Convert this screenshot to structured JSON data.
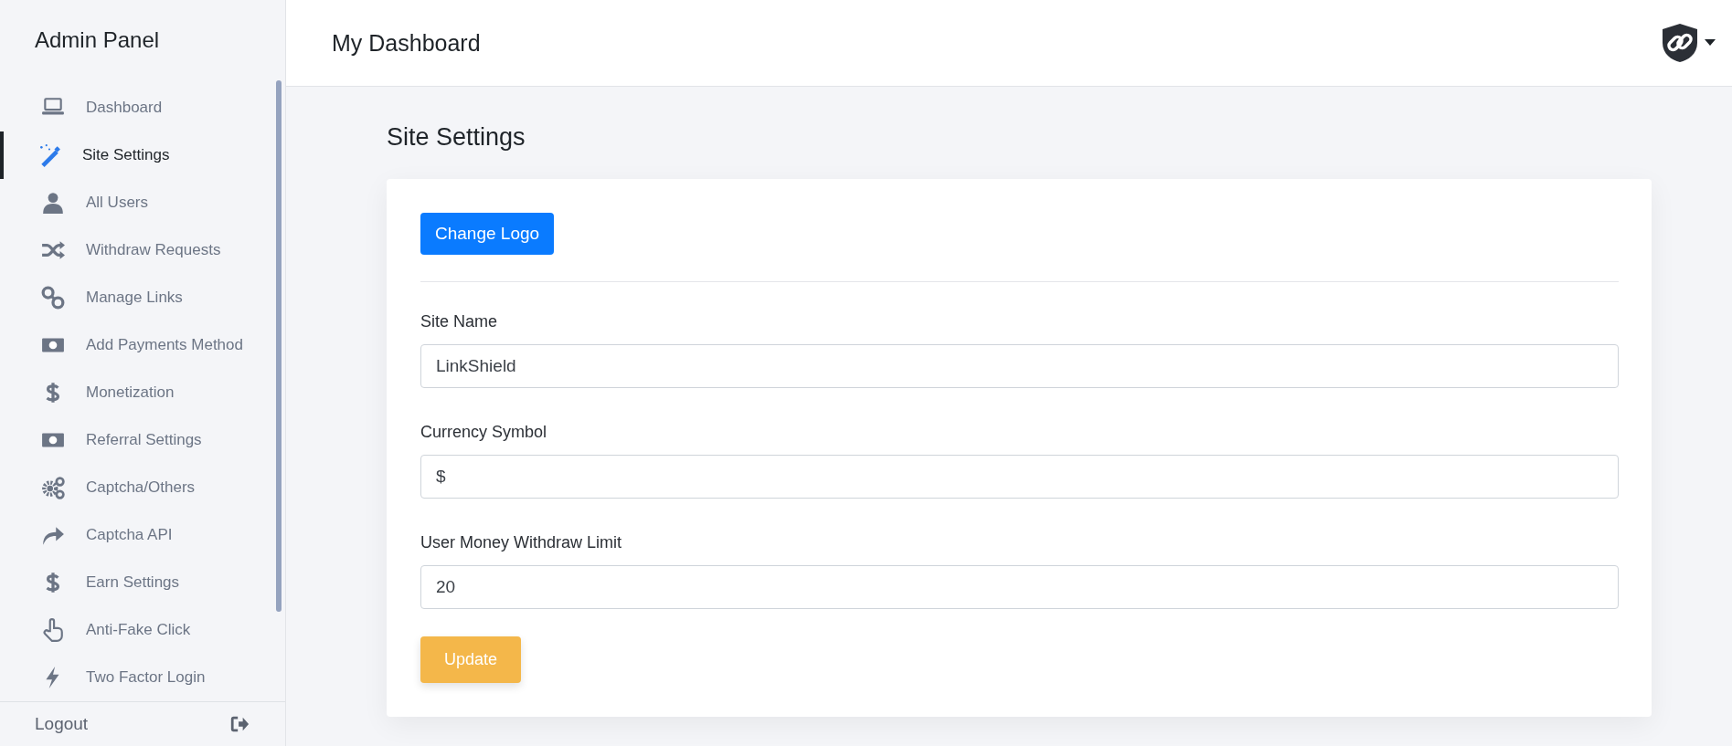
{
  "sidebar": {
    "title": "Admin Panel",
    "items": [
      {
        "label": "Dashboard",
        "selected": false
      },
      {
        "label": "Site Settings",
        "selected": true
      },
      {
        "label": "All Users",
        "selected": false
      },
      {
        "label": "Withdraw Requests",
        "selected": false
      },
      {
        "label": "Manage Links",
        "selected": false
      },
      {
        "label": "Add Payments Method",
        "selected": false
      },
      {
        "label": "Monetization",
        "selected": false
      },
      {
        "label": "Referral Settings",
        "selected": false
      },
      {
        "label": "Captcha/Others",
        "selected": false
      },
      {
        "label": "Captcha API",
        "selected": false
      },
      {
        "label": "Earn Settings",
        "selected": false
      },
      {
        "label": "Anti-Fake Click",
        "selected": false
      },
      {
        "label": "Two Factor Login",
        "selected": false
      }
    ],
    "logout": "Logout"
  },
  "header": {
    "title": "My Dashboard"
  },
  "page": {
    "title": "Site Settings",
    "change_logo_button": "Change Logo",
    "fields": [
      {
        "label": "Site Name",
        "value": "LinkShield"
      },
      {
        "label": "Currency Symbol",
        "value": "$"
      },
      {
        "label": "User Money Withdraw Limit",
        "value": "20"
      }
    ],
    "update_button": "Update"
  }
}
